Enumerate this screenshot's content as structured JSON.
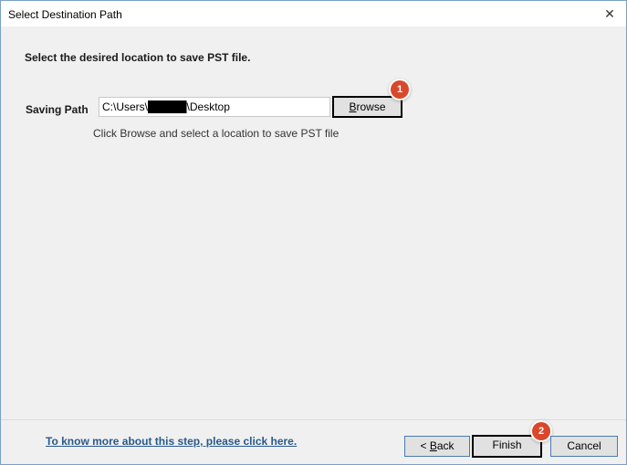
{
  "window": {
    "title": "Select Destination Path",
    "close_glyph": "✕"
  },
  "content": {
    "heading": "Select the desired location to save PST file.",
    "saving_path_label": "Saving Path",
    "saving_path_value": "C:\\Users\\█████\\Desktop",
    "browse_label_underlined": "B",
    "browse_label_rest": "rowse",
    "hint": "Click Browse and select a location to save PST file"
  },
  "annotations": {
    "badge_1": "1",
    "badge_2": "2",
    "badge_color": "#d9482b"
  },
  "footer": {
    "help_link": "To know more about this step, please click here.",
    "back_prefix": "< ",
    "back_underlined": "B",
    "back_rest": "ack",
    "finish": "Finish",
    "cancel": "Cancel"
  }
}
